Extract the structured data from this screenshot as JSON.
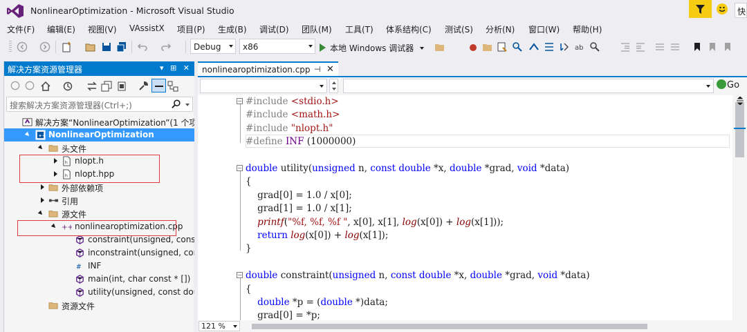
{
  "window": {
    "title": "NonlinearOptimization - Microsoft Visual Studio",
    "quick_launch": "快"
  },
  "menu": [
    "文件(F)",
    "编辑(E)",
    "视图(V)",
    "VAssistX",
    "项目(P)",
    "生成(B)",
    "调试(D)",
    "团队(M)",
    "工具(T)",
    "体系结构(C)",
    "测试(S)",
    "分析(N)",
    "窗口(W)",
    "帮助(H)"
  ],
  "toolbar": {
    "config": "Debug",
    "platform": "x86",
    "run_label": "本地 Windows 调试器"
  },
  "solution_explorer": {
    "title": "解决方案资源管理器",
    "header_controls": "▾ ⊞ ✕",
    "search_placeholder": "搜索解决方案资源管理器(Ctrl+;)",
    "tree": [
      {
        "label": "解决方案“NonlinearOptimization”(1 个项",
        "icon": "solution-icon",
        "expander": "none",
        "selected": false
      },
      {
        "label": "NonlinearOptimization",
        "icon": "project-icon",
        "expander": "open",
        "selected": true
      },
      {
        "label": "头文件",
        "icon": "folder-icon",
        "expander": "open",
        "selected": false
      },
      {
        "label": "nlopt.h",
        "icon": "header-file-icon",
        "expander": "closed",
        "selected": false
      },
      {
        "label": "nlopt.hpp",
        "icon": "header-file-icon",
        "expander": "closed",
        "selected": false
      },
      {
        "label": "外部依赖项",
        "icon": "folder-icon",
        "expander": "closed",
        "selected": false
      },
      {
        "label": "引用",
        "icon": "references-icon",
        "expander": "closed",
        "selected": false
      },
      {
        "label": "源文件",
        "icon": "folder-icon",
        "expander": "open",
        "selected": false
      },
      {
        "label": "nonlinearoptimization.cpp",
        "icon": "cpp-file-icon",
        "expander": "open",
        "selected": false
      },
      {
        "label": "constraint(unsigned, const do",
        "icon": "function-icon",
        "expander": "none",
        "selected": false
      },
      {
        "label": "inconstraint(unsigned, const d",
        "icon": "function-icon",
        "expander": "none",
        "selected": false
      },
      {
        "label": "INF",
        "icon": "macro-icon",
        "expander": "none",
        "selected": false
      },
      {
        "label": "main(int, char const * [])",
        "icon": "function-icon",
        "expander": "none",
        "selected": false
      },
      {
        "label": "utility(unsigned, const double",
        "icon": "function-icon",
        "expander": "none",
        "selected": false
      },
      {
        "label": "资源文件",
        "icon": "folder-icon",
        "expander": "none",
        "selected": false
      }
    ]
  },
  "editor": {
    "tab_label": "nonlinearoptimization.cpp",
    "tab_pin": "⊣",
    "tab_close": "✕",
    "go_label": "Go",
    "zoom": "121 %",
    "code": [
      {
        "fold": "−",
        "segments": [
          {
            "t": "#include ",
            "c": "pp"
          },
          {
            "t": "<stdio.h>",
            "c": "str"
          }
        ]
      },
      {
        "fold": "",
        "segments": [
          {
            "t": "#include ",
            "c": "pp"
          },
          {
            "t": "<math.h>",
            "c": "str"
          }
        ]
      },
      {
        "fold": "",
        "segments": [
          {
            "t": "#include ",
            "c": "pp"
          },
          {
            "t": "\"nlopt.h\"",
            "c": "str"
          }
        ]
      },
      {
        "fold": "",
        "segments": [
          {
            "t": "#define ",
            "c": "pp"
          },
          {
            "t": "INF",
            "c": "mac"
          },
          {
            "t": " (1000000)",
            "c": ""
          }
        ]
      },
      {
        "fold": "",
        "segments": []
      },
      {
        "fold": "−",
        "segments": [
          {
            "t": "double",
            "c": "kw"
          },
          {
            "t": " utility(",
            "c": ""
          },
          {
            "t": "unsigned",
            "c": "kw"
          },
          {
            "t": " n, ",
            "c": ""
          },
          {
            "t": "const",
            "c": "kw"
          },
          {
            "t": " ",
            "c": ""
          },
          {
            "t": "double",
            "c": "kw"
          },
          {
            "t": " *x, ",
            "c": ""
          },
          {
            "t": "double",
            "c": "kw"
          },
          {
            "t": " *grad, ",
            "c": ""
          },
          {
            "t": "void",
            "c": "kw"
          },
          {
            "t": " *data)",
            "c": ""
          }
        ]
      },
      {
        "fold": "",
        "segments": [
          {
            "t": "{",
            "c": ""
          }
        ]
      },
      {
        "fold": "",
        "segments": [
          {
            "t": "    grad[0] = 1.0 / x[0];",
            "c": ""
          }
        ]
      },
      {
        "fold": "",
        "segments": [
          {
            "t": "    grad[1] = 1.0 / x[1];",
            "c": ""
          }
        ]
      },
      {
        "fold": "",
        "segments": [
          {
            "t": "    ",
            "c": ""
          },
          {
            "t": "printf",
            "c": "fn"
          },
          {
            "t": "(",
            "c": ""
          },
          {
            "t": "\"%f, %f, %f \"",
            "c": "str"
          },
          {
            "t": ", x[0], x[1], ",
            "c": ""
          },
          {
            "t": "log",
            "c": "fn"
          },
          {
            "t": "(x[0]) + ",
            "c": ""
          },
          {
            "t": "log",
            "c": "fn"
          },
          {
            "t": "(x[1]));",
            "c": ""
          }
        ]
      },
      {
        "fold": "",
        "segments": [
          {
            "t": "    ",
            "c": ""
          },
          {
            "t": "return",
            "c": "kw"
          },
          {
            "t": " ",
            "c": ""
          },
          {
            "t": "log",
            "c": "fn"
          },
          {
            "t": "(x[0]) + ",
            "c": ""
          },
          {
            "t": "log",
            "c": "fn"
          },
          {
            "t": "(x[1]);",
            "c": ""
          }
        ]
      },
      {
        "fold": "",
        "segments": [
          {
            "t": "}",
            "c": ""
          }
        ]
      },
      {
        "fold": "",
        "segments": []
      },
      {
        "fold": "−",
        "segments": [
          {
            "t": "double",
            "c": "kw"
          },
          {
            "t": " constraint(",
            "c": ""
          },
          {
            "t": "unsigned",
            "c": "kw"
          },
          {
            "t": " n, ",
            "c": ""
          },
          {
            "t": "const",
            "c": "kw"
          },
          {
            "t": " ",
            "c": ""
          },
          {
            "t": "double",
            "c": "kw"
          },
          {
            "t": " *x, ",
            "c": ""
          },
          {
            "t": "double",
            "c": "kw"
          },
          {
            "t": " *grad, ",
            "c": ""
          },
          {
            "t": "void",
            "c": "kw"
          },
          {
            "t": " *data)",
            "c": ""
          }
        ]
      },
      {
        "fold": "",
        "segments": [
          {
            "t": "{",
            "c": ""
          }
        ]
      },
      {
        "fold": "",
        "segments": [
          {
            "t": "    ",
            "c": ""
          },
          {
            "t": "double",
            "c": "kw"
          },
          {
            "t": " *p = (",
            "c": ""
          },
          {
            "t": "double",
            "c": "kw"
          },
          {
            "t": " *)data;",
            "c": ""
          }
        ]
      },
      {
        "fold": "",
        "segments": [
          {
            "t": "    grad[0] = *p;",
            "c": ""
          }
        ]
      }
    ]
  },
  "colors": {
    "accent": "#007acc",
    "selection": "#3399ff",
    "highlight_box": "#e0393e",
    "keyword": "#0000ff",
    "string": "#a31515",
    "preprocessor": "#808080",
    "notify": "#f5cc11"
  }
}
